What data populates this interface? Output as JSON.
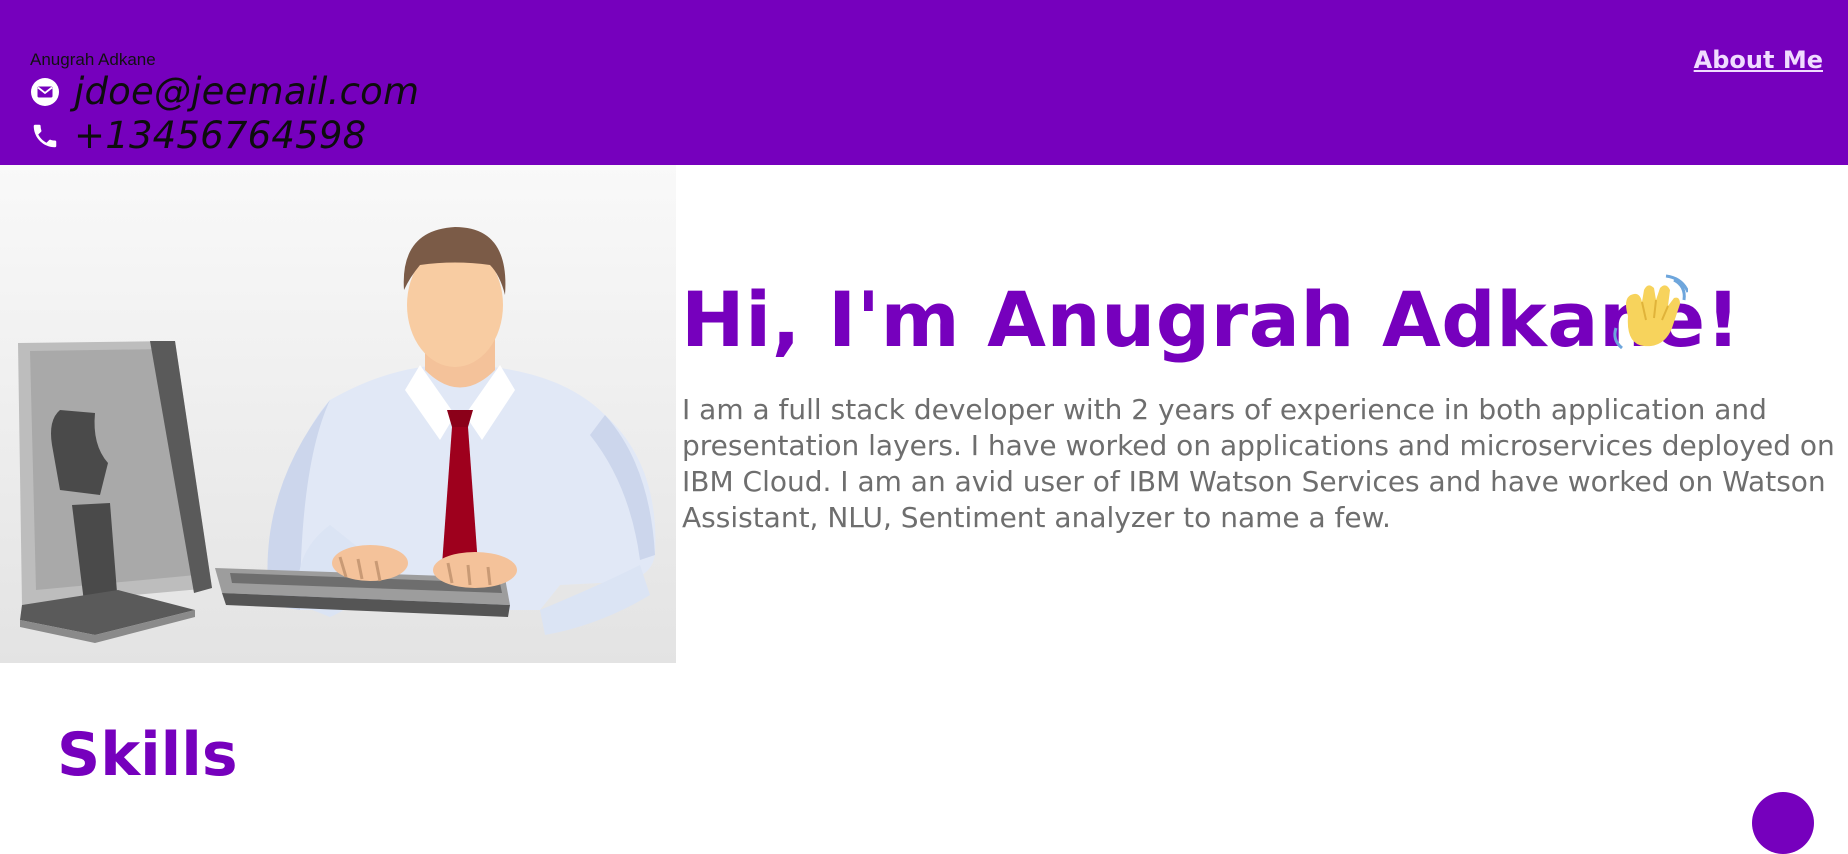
{
  "header": {
    "name": "Anugrah Adkane",
    "email": "jdoe@jeemail.com",
    "phone": "+13456764598",
    "nav_about": "About Me",
    "background_color": "#7600bd"
  },
  "icons": {
    "email": "email-icon",
    "phone": "phone-icon",
    "wave": "waving-hand-icon"
  },
  "hero": {
    "title": "Hi, I'm Anugrah Adkane!",
    "bio": "I am a full stack developer with 2 years of experience in both application and presentation layers. I have worked on applications and microservices deployed on IBM Cloud. I am an avid user of IBM Watson Services and have worked on Watson Assistant, NLU, Sentiment analyzer to name a few.",
    "accent_color": "#7600bd",
    "text_color": "#6e6e6e"
  },
  "sections": {
    "skills_heading": "Skills"
  }
}
